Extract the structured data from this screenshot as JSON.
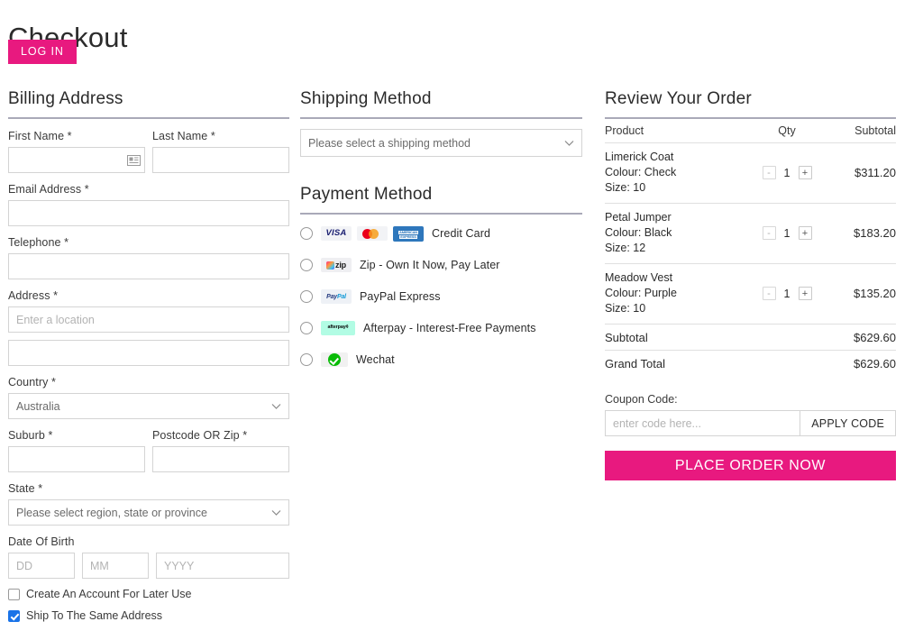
{
  "page": {
    "title": "Checkout",
    "login_button": "LOG IN"
  },
  "billing": {
    "heading": "Billing Address",
    "first_name": {
      "label": "First Name *",
      "value": "",
      "placeholder": "",
      "icon": "contact-card-icon"
    },
    "last_name": {
      "label": "Last Name *",
      "value": "",
      "placeholder": ""
    },
    "email": {
      "label": "Email Address *",
      "value": "",
      "placeholder": ""
    },
    "telephone": {
      "label": "Telephone *",
      "value": "",
      "placeholder": ""
    },
    "address": {
      "label": "Address *",
      "value": "",
      "placeholder": "Enter a location"
    },
    "address2": {
      "value": "",
      "placeholder": ""
    },
    "country": {
      "label": "Country *",
      "value": "Australia"
    },
    "suburb": {
      "label": "Suburb *",
      "value": "",
      "placeholder": ""
    },
    "postcode": {
      "label": "Postcode OR Zip *",
      "value": "",
      "placeholder": ""
    },
    "state": {
      "label": "State *",
      "value": "Please select region, state or province"
    },
    "dob": {
      "label": "Date Of Birth",
      "day": {
        "value": "",
        "placeholder": "DD"
      },
      "month": {
        "value": "",
        "placeholder": "MM"
      },
      "year": {
        "value": "",
        "placeholder": "YYYY"
      }
    },
    "create_account": {
      "label": "Create An Account For Later Use",
      "checked": false
    },
    "ship_same": {
      "label": "Ship To The Same Address",
      "checked": true
    }
  },
  "shipping": {
    "heading": "Shipping Method",
    "select_value": "Please select a shipping method"
  },
  "payment": {
    "heading": "Payment Method",
    "options": [
      {
        "label": "Credit Card",
        "logos": [
          "visa-logo",
          "mastercard-logo",
          "amex-logo"
        ],
        "selected": false
      },
      {
        "label": "Zip - Own It Now, Pay Later",
        "logos": [
          "zip-logo"
        ],
        "selected": false
      },
      {
        "label": "PayPal Express",
        "logos": [
          "paypal-logo"
        ],
        "selected": false
      },
      {
        "label": "Afterpay - Interest-Free Payments",
        "logos": [
          "afterpay-logo"
        ],
        "selected": false
      },
      {
        "label": "Wechat",
        "logos": [
          "wechat-logo"
        ],
        "selected": false
      }
    ],
    "logo_text": {
      "visa": "VISA",
      "amex_top": "AMERICAN",
      "amex_bottom": "EXPRESS",
      "zip": "zip",
      "paypal_pay": "Pay",
      "paypal_pal": "Pal",
      "afterpay": "afterpay¢"
    }
  },
  "review": {
    "heading": "Review Your Order",
    "columns": {
      "product": "Product",
      "qty": "Qty",
      "subtotal": "Subtotal"
    },
    "items": [
      {
        "name": "Limerick Coat",
        "colour": "Colour: Check",
        "size": "Size: 10",
        "qty": "1",
        "subtotal": "$311.20",
        "minus": "-",
        "plus": "+"
      },
      {
        "name": "Petal Jumper",
        "colour": "Colour: Black",
        "size": "Size: 12",
        "qty": "1",
        "subtotal": "$183.20",
        "minus": "-",
        "plus": "+"
      },
      {
        "name": "Meadow Vest",
        "colour": "Colour: Purple",
        "size": "Size: 10",
        "qty": "1",
        "subtotal": "$135.20",
        "minus": "-",
        "plus": "+"
      }
    ],
    "subtotal_label": "Subtotal",
    "subtotal_value": "$629.60",
    "grand_total_label": "Grand Total",
    "grand_total_value": "$629.60",
    "coupon_label": "Coupon Code:",
    "coupon_placeholder": "enter code here...",
    "coupon_value": "",
    "apply_button": "APPLY CODE",
    "place_order_button": "PLACE ORDER NOW"
  },
  "colors": {
    "brand_pink": "#e8197f",
    "rule_grey": "#a9a9b8",
    "border_grey": "#d4d4d4",
    "checkbox_blue": "#1a73e8",
    "wechat_green": "#09bb07",
    "afterpay_mint": "#b2fce4"
  }
}
